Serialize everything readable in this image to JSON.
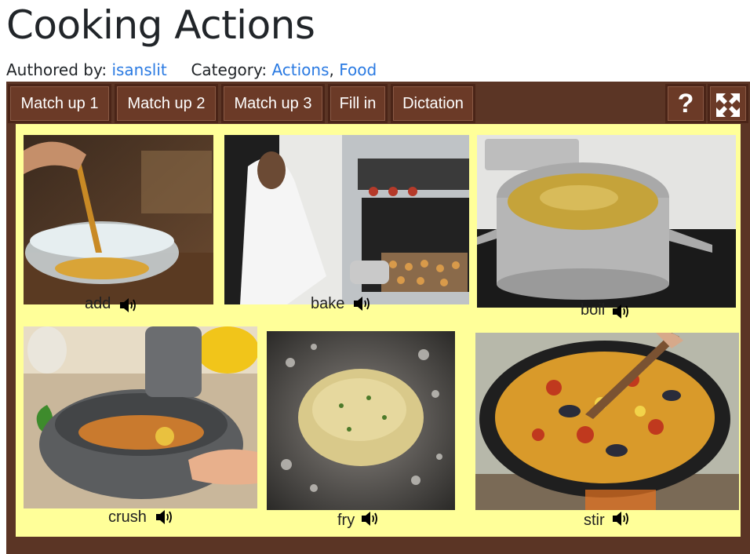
{
  "header": {
    "title": "Cooking Actions",
    "authored_label": "Authored by:",
    "author": "isanslit",
    "category_label": "Category:",
    "categories": [
      "Actions",
      "Food"
    ],
    "category_separator": ","
  },
  "toolbar": {
    "buttons": [
      "Match up 1",
      "Match up 2",
      "Match up 3",
      "Fill in",
      "Dictation"
    ],
    "help": "?",
    "fullscreen_icon": "fullscreen-icon"
  },
  "colors": {
    "frame": "#5b3525",
    "button": "#6b3a27",
    "board": "#ffff99",
    "link": "#2a7ae2"
  },
  "cards": [
    {
      "word": "add",
      "image": "spice-pouring-into-bowl-photo",
      "icon": "speaker-icon"
    },
    {
      "word": "bake",
      "image": "woman-taking-cookies-from-oven-photo",
      "icon": "speaker-icon"
    },
    {
      "word": "boil",
      "image": "pot-of-boiling-water-photo",
      "icon": "speaker-icon"
    },
    {
      "word": "crush",
      "image": "mortar-and-pestle-spices-photo",
      "icon": "speaker-icon"
    },
    {
      "word": "fry",
      "image": "food-frying-in-oil-photo",
      "icon": "speaker-icon"
    },
    {
      "word": "stir",
      "image": "stirring-paella-pan-photo",
      "icon": "speaker-icon"
    }
  ]
}
